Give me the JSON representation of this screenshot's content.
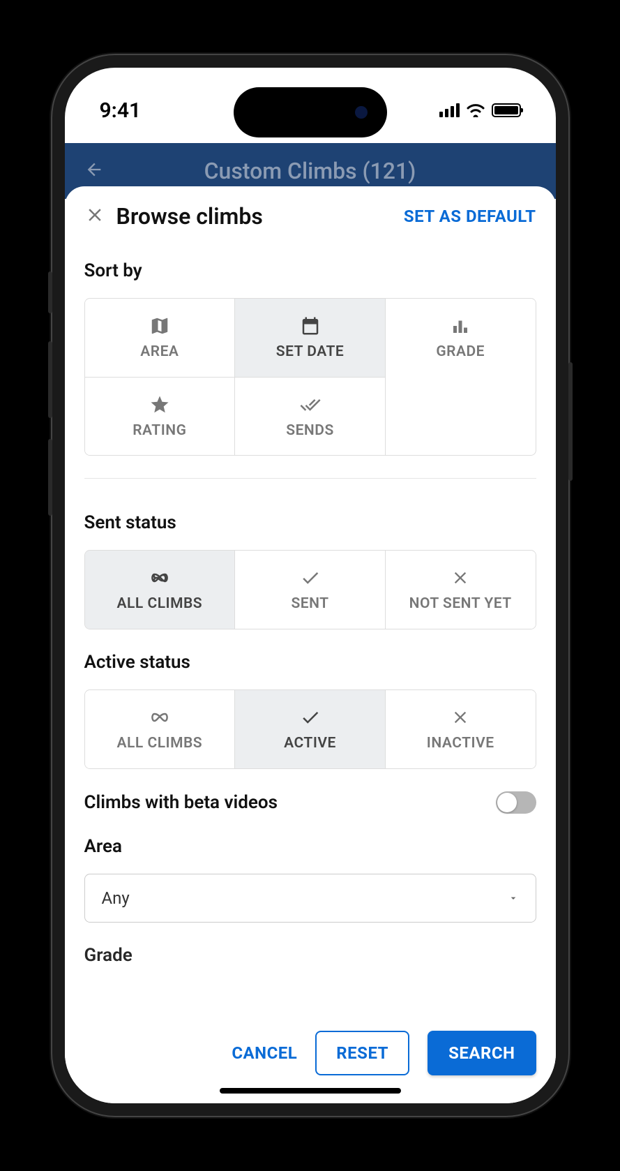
{
  "status": {
    "time": "9:41"
  },
  "appbar": {
    "title": "Custom Climbs (121)"
  },
  "sheet": {
    "title": "Browse climbs",
    "set_default": "SET AS DEFAULT"
  },
  "sort": {
    "label": "Sort by",
    "options": {
      "area": "AREA",
      "set_date": "SET DATE",
      "grade": "GRADE",
      "rating": "RATING",
      "sends": "SENDS"
    }
  },
  "sent_status": {
    "label": "Sent status",
    "options": {
      "all": "ALL CLIMBS",
      "sent": "SENT",
      "not_sent": "NOT SENT YET"
    }
  },
  "active_status": {
    "label": "Active status",
    "options": {
      "all": "ALL CLIMBS",
      "active": "ACTIVE",
      "inactive": "INACTIVE"
    }
  },
  "beta_videos": {
    "label": "Climbs with beta videos"
  },
  "area": {
    "label": "Area",
    "value": "Any"
  },
  "grade": {
    "label": "Grade"
  },
  "buttons": {
    "cancel": "CANCEL",
    "reset": "RESET",
    "search": "SEARCH"
  }
}
